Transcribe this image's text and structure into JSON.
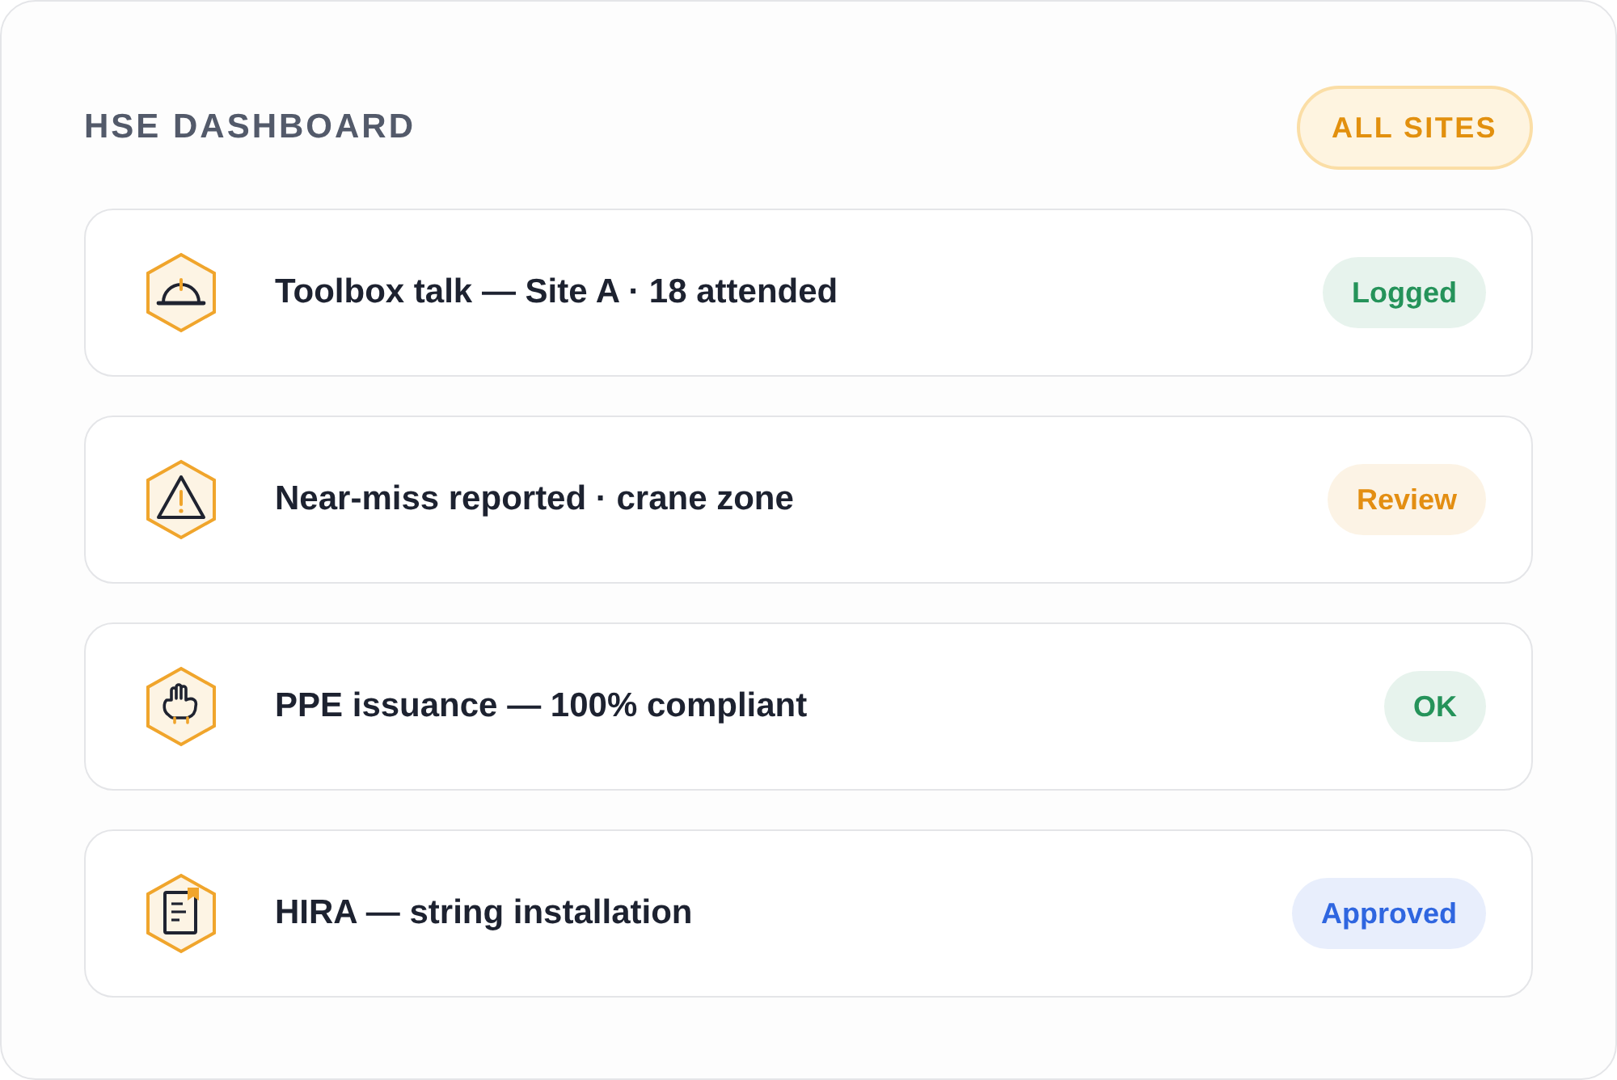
{
  "header": {
    "title": "HSE DASHBOARD",
    "filter": "ALL SITES"
  },
  "items": [
    {
      "text": "Toolbox talk — Site A · 18 attended",
      "status": "Logged",
      "color": "#25935a"
    },
    {
      "text": "Near-miss reported · crane zone",
      "status": "Review",
      "color": "#e38e12"
    },
    {
      "text": "PPE issuance — 100% compliant",
      "status": "OK",
      "color": "#25935a"
    },
    {
      "text": "HIRA — string installation",
      "status": "Approved",
      "color": "#2f66e0"
    }
  ]
}
